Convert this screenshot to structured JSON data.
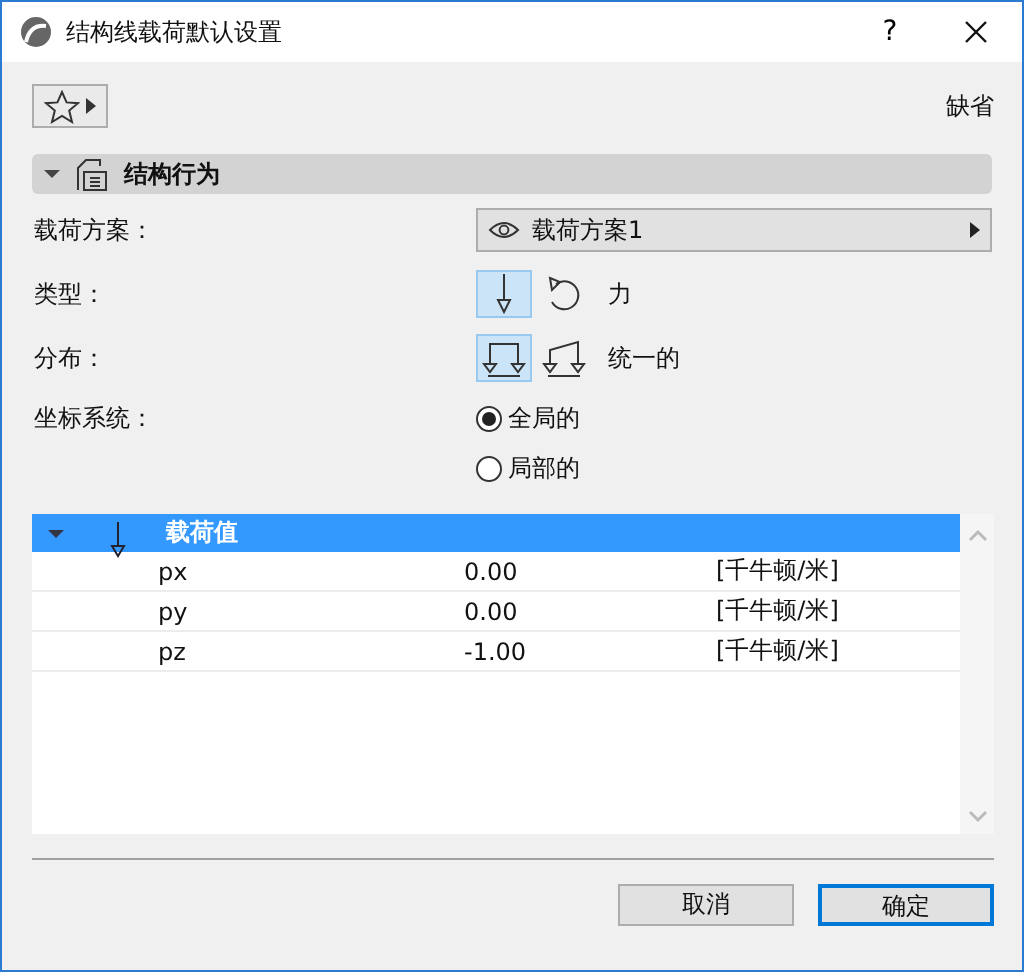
{
  "window": {
    "title": "结构线载荷默认设置",
    "help": "?"
  },
  "toolbar": {
    "preset_label": "缺省"
  },
  "section": {
    "title": "结构行为",
    "expanded": true
  },
  "load_case": {
    "label": "载荷方案：",
    "value": "载荷方案1"
  },
  "type": {
    "label": "类型：",
    "options": [
      {
        "kind": "force",
        "selected": true
      },
      {
        "kind": "moment",
        "selected": false
      }
    ],
    "value": "力"
  },
  "distribution": {
    "label": "分布：",
    "options": [
      {
        "kind": "uniform",
        "selected": true
      },
      {
        "kind": "linear",
        "selected": false
      }
    ],
    "value": "统一的"
  },
  "coordinate_system": {
    "label": "坐标系统：",
    "options": [
      {
        "label": "全局的",
        "selected": true
      },
      {
        "label": "局部的",
        "selected": false
      }
    ]
  },
  "table": {
    "group": {
      "title": "载荷值",
      "expanded": true
    },
    "rows": [
      {
        "name": "px",
        "value": "0.00",
        "unit": "[千牛顿/米]"
      },
      {
        "name": "py",
        "value": "0.00",
        "unit": "[千牛顿/米]"
      },
      {
        "name": "pz",
        "value": "-1.00",
        "unit": "[千牛顿/米]"
      }
    ]
  },
  "buttons": [
    {
      "label": "取消",
      "default": false
    },
    {
      "label": "确定",
      "default": true
    }
  ]
}
